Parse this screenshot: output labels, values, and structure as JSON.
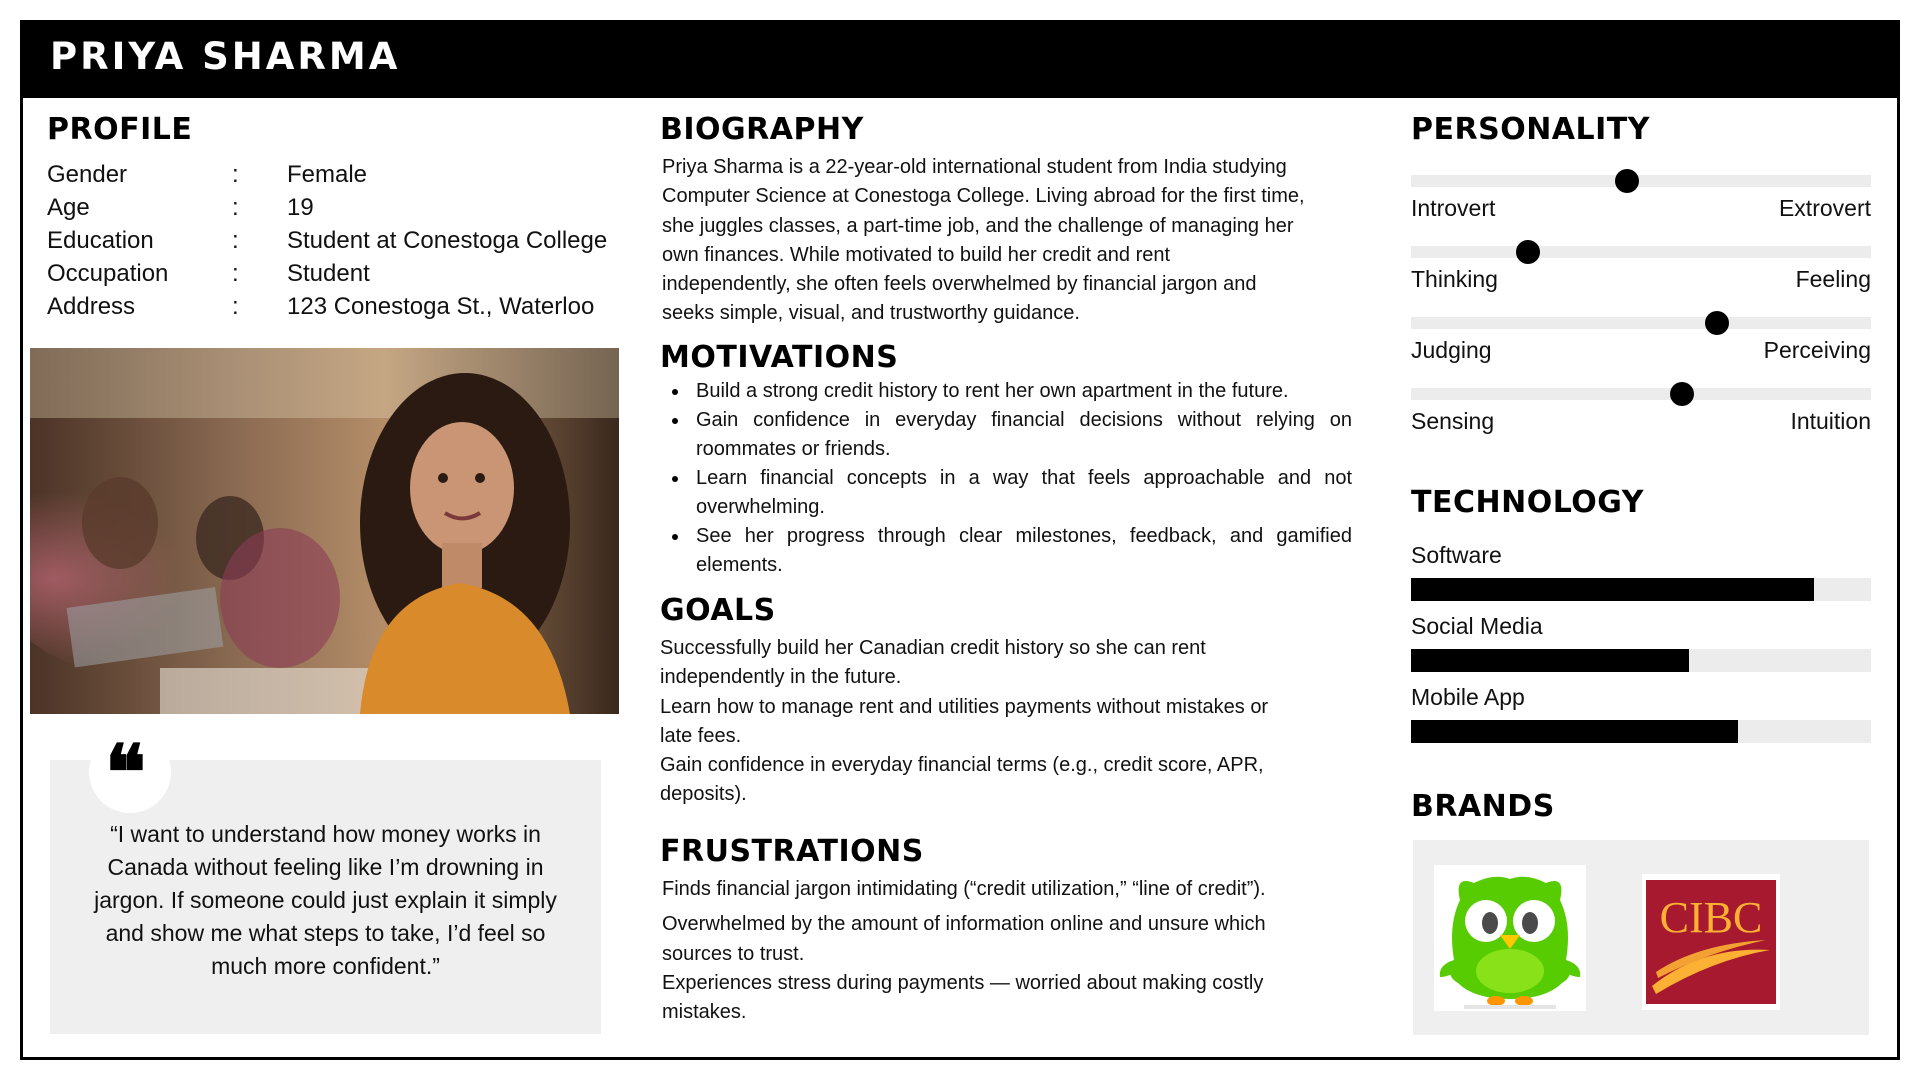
{
  "persona": {
    "name": "PRIYA SHARMA"
  },
  "profile": {
    "title": "PROFILE",
    "rows": [
      {
        "label": "Gender",
        "sep": ":",
        "value": "Female"
      },
      {
        "label": "Age",
        "sep": ":",
        "value": "19"
      },
      {
        "label": "Education",
        "sep": ":",
        "value": "Student at Conestoga College"
      },
      {
        "label": "Occupation",
        "sep": ":",
        "value": "Student"
      },
      {
        "label": "Address",
        "sep": ":",
        "value": "123 Conestoga St., Waterloo"
      }
    ],
    "quote": "“I want to understand how money works in Canada without feeling like I’m drowning in jargon. If someone could just explain it simply and show me what steps to take, I’d feel so much more confident.”"
  },
  "biography": {
    "title": "BIOGRAPHY",
    "lines": [
      "Priya Sharma is a 22-year-old international student from India studying",
      "Computer Science at Conestoga College. Living abroad for the first time,",
      "she juggles classes, a part-time job, and the challenge of managing her",
      "own finances. While motivated to build her credit and rent",
      "independently, she often feels overwhelmed by financial jargon and",
      "seeks simple, visual, and trustworthy guidance."
    ]
  },
  "motivations": {
    "title": "MOTIVATIONS",
    "items": [
      "Build a strong credit history to rent her own apartment in the future.",
      "Gain confidence in everyday financial decisions without relying on roommates or friends.",
      "Learn financial concepts in a way that feels approachable and not overwhelming.",
      "See her progress through clear milestones, feedback, and gamified elements."
    ]
  },
  "goals": {
    "title": "GOALS",
    "lines": [
      "Successfully build her Canadian credit history so she can rent",
      "independently in the future.",
      "Learn how to manage rent and utilities payments without mistakes or",
      "late fees.",
      "Gain confidence in everyday financial terms (e.g., credit score, APR,",
      "deposits)."
    ]
  },
  "frustrations": {
    "title": "FRUSTRATIONS",
    "lines": [
      "Finds financial jargon intimidating (“credit utilization,” “line of credit”).",
      "Overwhelmed by the amount of information online and unsure which",
      "sources to trust.",
      "Experiences stress during payments — worried about making costly",
      "mistakes."
    ]
  },
  "personality": {
    "title": "PERSONALITY",
    "traits": [
      {
        "left": "Introvert",
        "right": "Extrovert",
        "position": 0.47
      },
      {
        "left": "Thinking",
        "right": "Feeling",
        "position": 0.255
      },
      {
        "left": "Judging",
        "right": "Perceiving",
        "position": 0.665
      },
      {
        "left": "Sensing",
        "right": "Intuition",
        "position": 0.59
      }
    ]
  },
  "technology": {
    "title": "TECHNOLOGY",
    "items": [
      {
        "label": "Software",
        "level": 0.875
      },
      {
        "label": "Social Media",
        "level": 0.605
      },
      {
        "label": "Mobile App",
        "level": 0.71
      }
    ]
  },
  "brands": {
    "title": "BRANDS",
    "logos": [
      {
        "name": "duolingo-owl-logo",
        "color": "#58cc02"
      },
      {
        "name": "cibc-logo",
        "text": "CIBC",
        "color": "#a6192e",
        "accent": "#fcb034"
      }
    ]
  }
}
